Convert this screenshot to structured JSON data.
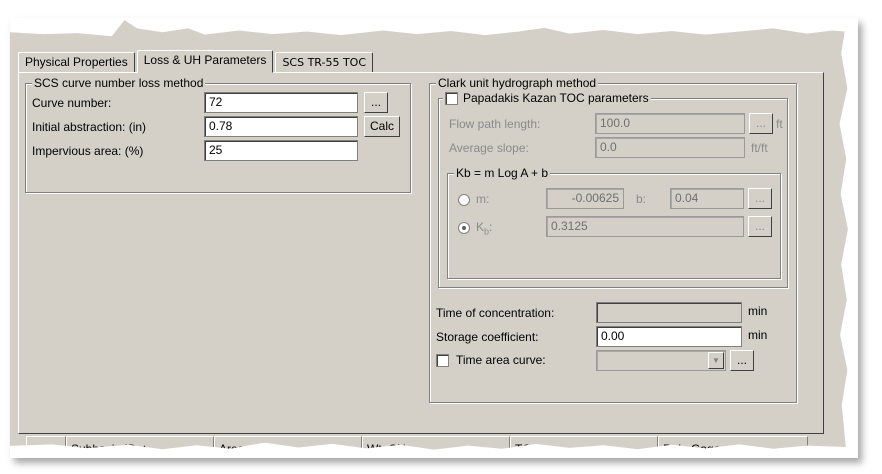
{
  "tabs": [
    {
      "label": "Physical Properties"
    },
    {
      "label": "Loss & UH Parameters",
      "active": true
    },
    {
      "label": "SCS TR-55 TOC"
    }
  ],
  "scs_group": {
    "title": "SCS curve number loss method",
    "curve_number_label": "Curve number:",
    "curve_number_value": "72",
    "curve_number_button": "...",
    "initial_abstraction_label": "Initial abstraction: (in)",
    "initial_abstraction_value": "0.78",
    "calc_button": "Calc",
    "impervious_label": "Impervious area: (%)",
    "impervious_value": "25"
  },
  "clark_group": {
    "title": "Clark unit hydrograph method",
    "papadakis": {
      "title": "Papadakis Kazan TOC parameters",
      "checked": false,
      "flow_path_label": "Flow path length:",
      "flow_path_value": "100.0",
      "flow_path_button": "...",
      "flow_path_unit": "ft",
      "slope_label": "Average slope:",
      "slope_value": "0.0",
      "slope_unit": "ft/ft",
      "kb_group": {
        "title": "Kb = m Log A + b",
        "m_label": "m:",
        "m_value": "-0.00625",
        "b_label": "b:",
        "b_value": "0.04",
        "b_button": "...",
        "kb_label": "K",
        "kb_sub": "b",
        "kb_suffix": ":",
        "kb_value": "0.3125",
        "kb_button": "...",
        "selected": "kb"
      }
    },
    "toc_label": "Time of concentration:",
    "toc_value": "",
    "toc_unit": "min",
    "storage_label": "Storage coefficient:",
    "storage_value": "0.00",
    "storage_unit": "min",
    "time_area_label": "Time area curve:",
    "time_area_checked": false,
    "time_area_value": "",
    "time_area_button": "..."
  },
  "grid_columns": [
    {
      "label": ""
    },
    {
      "label": "Subbasin ID △"
    },
    {
      "label": "Area"
    },
    {
      "label": "Wt. CN"
    },
    {
      "label": "TOC"
    },
    {
      "label": "Rain Gage"
    }
  ],
  "colors": {
    "dialog_bg": "#d4d0c8",
    "field_bg": "#ffffff"
  }
}
